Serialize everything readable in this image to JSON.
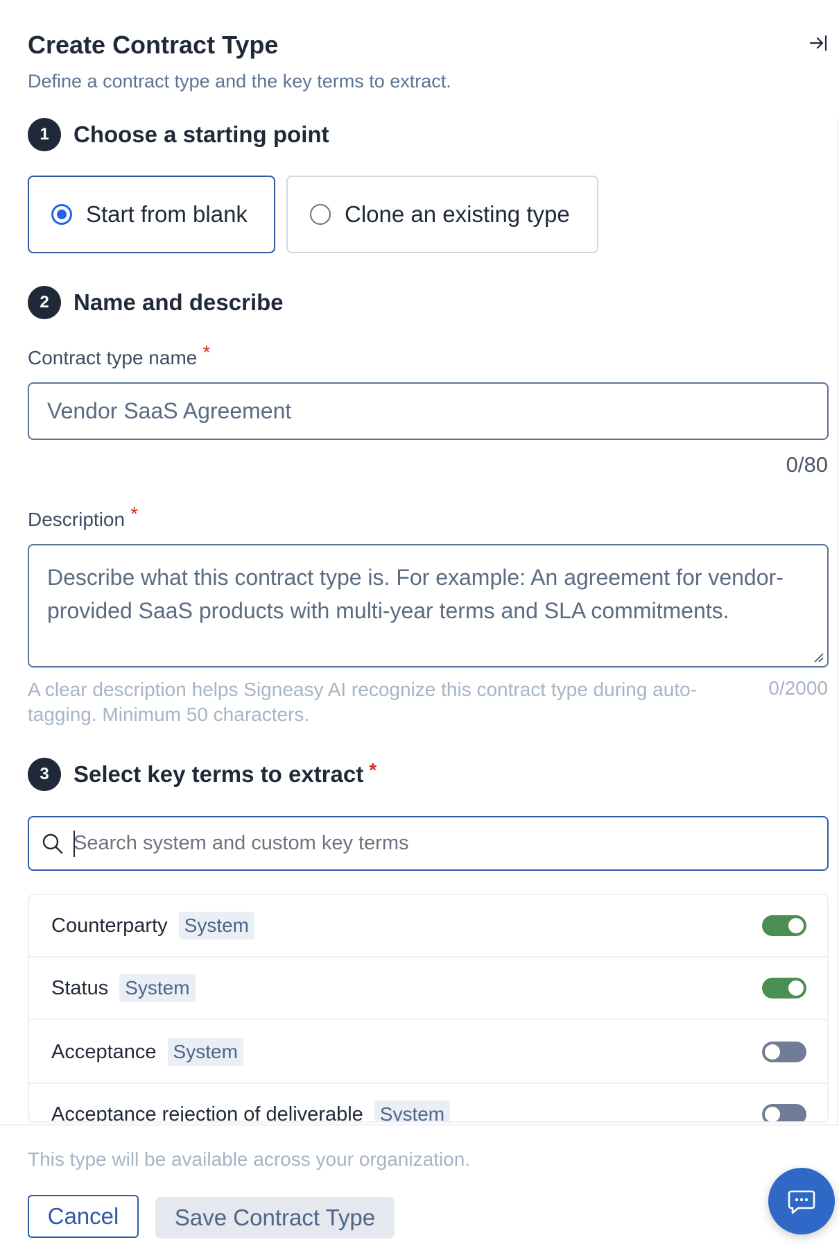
{
  "header": {
    "title": "Create Contract Type",
    "subtitle": "Define a contract type and the key terms to extract.",
    "collapse_icon": "collapse-panel-right-icon"
  },
  "steps": [
    {
      "number": "1",
      "title": "Choose a starting point"
    },
    {
      "number": "2",
      "title": "Name and describe"
    },
    {
      "number": "3",
      "title": "Select key terms to extract",
      "required_mark": "*"
    }
  ],
  "starting_point": {
    "options": [
      {
        "label": "Start from blank",
        "selected": true
      },
      {
        "label": "Clone an existing type",
        "selected": false
      }
    ]
  },
  "name_field": {
    "label": "Contract type name",
    "required_mark": "*",
    "placeholder": "Vendor SaaS Agreement",
    "value": "",
    "counter": "0/80"
  },
  "description_field": {
    "label": "Description",
    "required_mark": "*",
    "placeholder": "Describe what this contract type is. For example: An agreement for vendor-provided SaaS products with multi-year terms and SLA commitments.",
    "value": "",
    "helper": "A clear description helps Signeasy AI recognize this contract type during auto-tagging. Minimum 50 characters.",
    "counter": "0/2000"
  },
  "key_terms": {
    "search_placeholder": "Search system and custom key terms",
    "items": [
      {
        "name": "Counterparty",
        "tag": "System",
        "enabled": true
      },
      {
        "name": "Status",
        "tag": "System",
        "enabled": true
      },
      {
        "name": "Acceptance",
        "tag": "System",
        "enabled": false
      },
      {
        "name": "Acceptance rejection of deliverable",
        "tag": "System",
        "enabled": false
      }
    ]
  },
  "footer": {
    "note": "This type will be available across your organization.",
    "cancel_label": "Cancel",
    "save_label": "Save Contract Type",
    "chat_icon": "chat-bubble-icon"
  },
  "colors": {
    "accent": "#2f5aa8",
    "toggle_on": "#4a8e52",
    "toggle_off": "#717d96",
    "required": "#d92d20",
    "fab": "#2f68c6"
  }
}
